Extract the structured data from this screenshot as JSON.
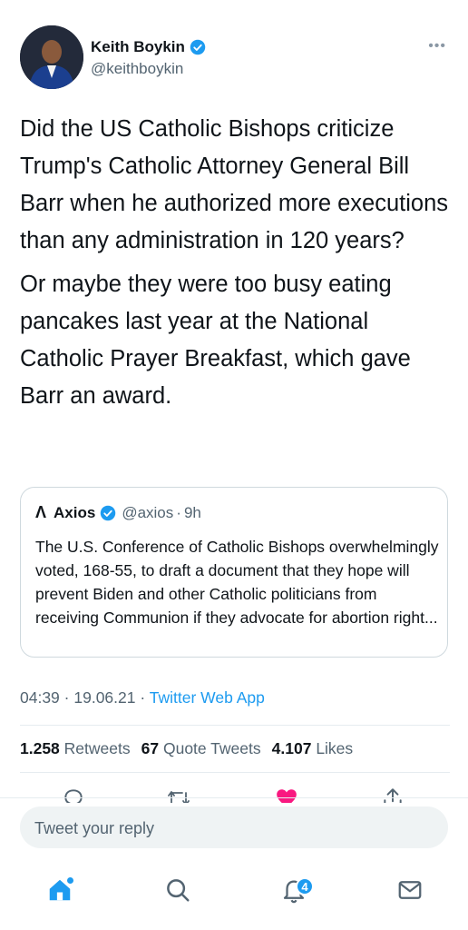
{
  "tweet": {
    "author_name": "Keith Boykin",
    "author_handle": "@keithboykin",
    "paragraphs": [
      "Did the US Catholic Bishops criticize Trump's Catholic Attorney General Bill Barr when he authorized more executions than any administration in 120 years?",
      "Or maybe they were too busy eating pancakes last year at the National Catholic Prayer Breakfast, which gave Barr an award."
    ],
    "time": "04:39",
    "date": "19.06.21",
    "source": "Twitter Web App"
  },
  "quote": {
    "logo": "Λ",
    "name": "Axios",
    "handle": "@axios",
    "age": "9h",
    "text": "The U.S. Conference of Catholic Bishops overwhelmingly voted, 168-55, to draft a document that they hope will prevent Biden and other Catholic politicians from receiving Communion if they advocate for abortion right..."
  },
  "stats": {
    "retweets_count": "1.258",
    "retweets_label": "Retweets",
    "quotes_count": "67",
    "quotes_label": "Quote Tweets",
    "likes_count": "4.107",
    "likes_label": "Likes"
  },
  "reply": {
    "placeholder": "Tweet your reply"
  },
  "tabbar": {
    "notifications_badge": "4"
  },
  "icons": {
    "more": "more-icon",
    "verified": "verified-badge-icon",
    "reply": "reply-icon",
    "retweet": "retweet-icon",
    "like": "heart-icon",
    "share": "share-icon",
    "home": "home-icon",
    "search": "search-icon",
    "notifications": "bell-icon",
    "messages": "mail-icon"
  },
  "colors": {
    "accent": "#1d9bf0",
    "like": "#f91880",
    "text": "#0f1419",
    "muted": "#536471"
  }
}
